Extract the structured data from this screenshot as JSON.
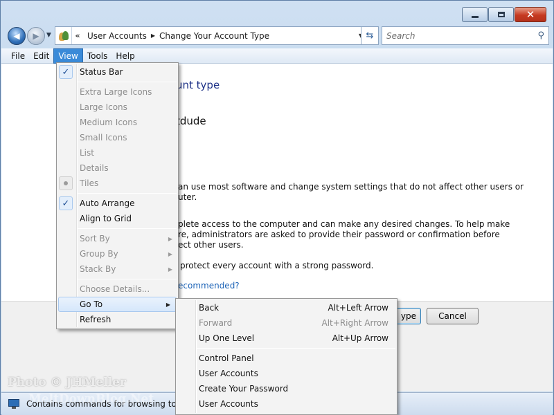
{
  "window": {
    "title_buttons": [
      "minimize",
      "maximize",
      "close"
    ]
  },
  "address": {
    "crumbs": [
      "User Accounts",
      "Change Your Account Type"
    ],
    "search_placeholder": "Search"
  },
  "menubar": [
    "File",
    "Edit",
    "View",
    "Tools",
    "Help"
  ],
  "content": {
    "heading": "unt type",
    "account_name": "tdude",
    "line1a": "an use most software and change system settings that do not affect other users or",
    "line1b": "uter.",
    "line2a": "plete access to the computer and can make any desired changes. To help make",
    "line2b": "re, administrators are asked to provide their password or confirmation before",
    "line2c": "ect other users.",
    "line3": "protect every account with a strong password.",
    "link": "ecommended?",
    "primary_button": "ype",
    "cancel_button": "Cancel"
  },
  "view_menu": {
    "status_bar": "Status Bar",
    "extra_large": "Extra Large Icons",
    "large": "Large Icons",
    "medium": "Medium Icons",
    "small": "Small Icons",
    "list": "List",
    "details": "Details",
    "tiles": "Tiles",
    "auto_arrange": "Auto Arrange",
    "align_grid": "Align to Grid",
    "sort_by": "Sort By",
    "group_by": "Group By",
    "stack_by": "Stack By",
    "choose_details": "Choose Details...",
    "go_to": "Go To",
    "refresh": "Refresh"
  },
  "goto_menu": {
    "back": "Back",
    "back_key": "Alt+Left Arrow",
    "forward": "Forward",
    "forward_key": "Alt+Right Arrow",
    "up": "Up One Level",
    "up_key": "Alt+Up Arrow",
    "control_panel": "Control Panel",
    "user_accounts": "User Accounts",
    "create_password": "Create Your Password",
    "user_accounts2": "User Accounts"
  },
  "status": {
    "text": "Contains commands for browsing to vari"
  },
  "watermark": {
    "line1": "Photo © JHMeller",
    "line2": "MeltDownBlog.Net"
  },
  "colors": {
    "accent": "#3a8ad8",
    "link": "#1c63b7",
    "heading": "#1e3287"
  }
}
